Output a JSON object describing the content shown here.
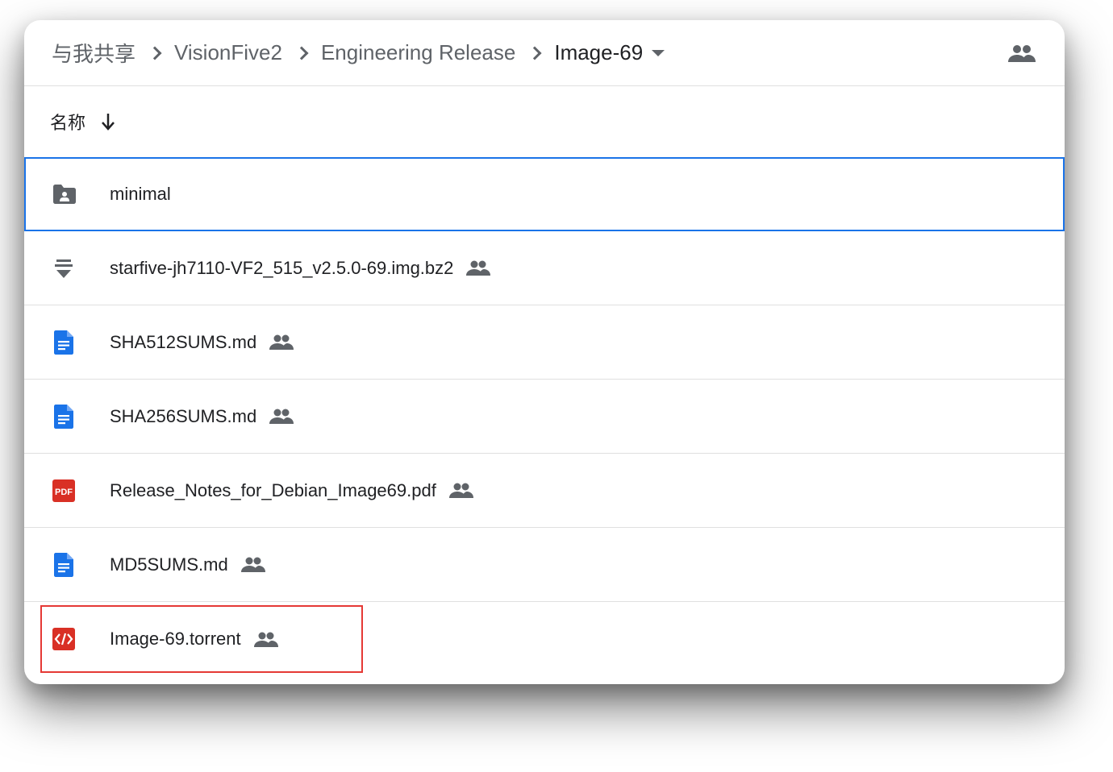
{
  "breadcrumb": {
    "items": [
      {
        "label": "与我共享"
      },
      {
        "label": "VisionFive2"
      },
      {
        "label": "Engineering Release"
      },
      {
        "label": "Image-69",
        "current": true
      }
    ]
  },
  "column": {
    "name_label": "名称",
    "sort_direction": "down"
  },
  "rows": [
    {
      "icon": "folder-shared",
      "name": "minimal",
      "shared": false,
      "selected": true,
      "highlighted": false
    },
    {
      "icon": "queue",
      "name": "starfive-jh7110-VF2_515_v2.5.0-69.img.bz2",
      "shared": true,
      "selected": false,
      "highlighted": false
    },
    {
      "icon": "doc",
      "name": "SHA512SUMS.md",
      "shared": true,
      "selected": false,
      "highlighted": false
    },
    {
      "icon": "doc",
      "name": "SHA256SUMS.md",
      "shared": true,
      "selected": false,
      "highlighted": false
    },
    {
      "icon": "pdf",
      "name": "Release_Notes_for_Debian_Image69.pdf",
      "shared": true,
      "selected": false,
      "highlighted": false
    },
    {
      "icon": "doc",
      "name": "MD5SUMS.md",
      "shared": true,
      "selected": false,
      "highlighted": false
    },
    {
      "icon": "code",
      "name": "Image-69.torrent",
      "shared": true,
      "selected": false,
      "highlighted": true
    }
  ],
  "colors": {
    "accent": "#1a73e8",
    "highlight": "#e53935",
    "text": "#202124",
    "muted": "#5f6368",
    "divider": "#e0e0e0"
  }
}
